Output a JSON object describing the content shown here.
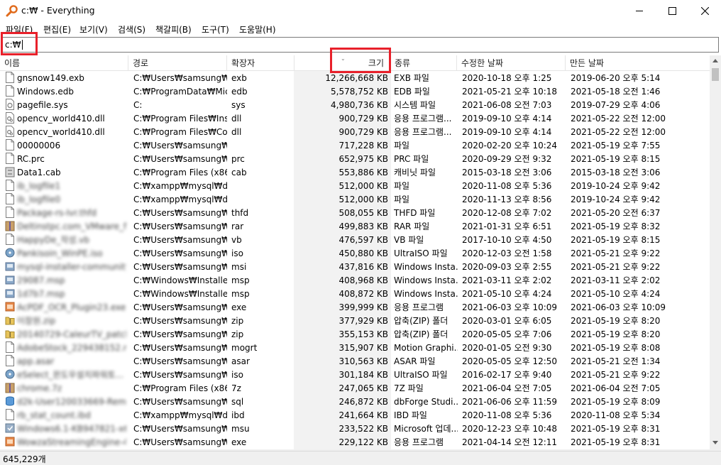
{
  "window": {
    "title": "c:₩ - Everything"
  },
  "menu": [
    "파일(F)",
    "편집(E)",
    "보기(V)",
    "검색(S)",
    "책갈피(B)",
    "도구(T)",
    "도움말(H)"
  ],
  "search": {
    "value": "c:₩"
  },
  "columns": {
    "name": "이름",
    "path": "경로",
    "ext": "확장자",
    "size": "크기",
    "type": "종류",
    "modified": "수정한 날짜",
    "created": "만든 날짜"
  },
  "rows": [
    {
      "name": "gnsnow149.exb",
      "path": "C:₩Users₩samsung₩E...",
      "ext": "exb",
      "size": "12,266,668 KB",
      "type": "EXB 파일",
      "modified": "2020-10-18 오후 1:25",
      "created": "2019-06-20 오후 5:14",
      "icon": "file-icon"
    },
    {
      "name": "Windows.edb",
      "path": "C:₩ProgramData₩Mic...",
      "ext": "edb",
      "size": "5,578,752 KB",
      "type": "EDB 파일",
      "modified": "2021-05-21 오후 10:18",
      "created": "2021-05-18 오전 1:46",
      "icon": "file-icon"
    },
    {
      "name": "pagefile.sys",
      "path": "C:",
      "ext": "sys",
      "size": "4,980,736 KB",
      "type": "시스템 파일",
      "modified": "2021-06-08 오전 7:03",
      "created": "2019-07-29 오후 4:06",
      "icon": "system-file-icon"
    },
    {
      "name": "opencv_world410.dll",
      "path": "C:₩Program Files₩Inst...",
      "ext": "dll",
      "size": "900,729 KB",
      "type": "응용 프로그램...",
      "modified": "2019-09-10 오후 4:14",
      "created": "2021-05-22 오전 12:00",
      "icon": "dll-file-icon"
    },
    {
      "name": "opencv_world410.dll",
      "path": "C:₩Program Files₩Co...",
      "ext": "dll",
      "size": "900,729 KB",
      "type": "응용 프로그램...",
      "modified": "2019-09-10 오후 4:14",
      "created": "2021-05-22 오전 12:00",
      "icon": "dll-file-icon"
    },
    {
      "name": "00000006",
      "path": "C:₩Users₩samsung₩...",
      "ext": "",
      "size": "717,228 KB",
      "type": "파일",
      "modified": "2020-02-20 오후 10:24",
      "created": "2021-05-19 오후 7:55",
      "icon": "file-icon"
    },
    {
      "name": "RC.prc",
      "path": "C:₩Users₩samsung₩...",
      "ext": "prc",
      "size": "652,975 KB",
      "type": "PRC 파일",
      "modified": "2020-09-29 오전 9:32",
      "created": "2021-05-19 오후 8:15",
      "icon": "file-icon"
    },
    {
      "name": "Data1.cab",
      "path": "C:₩Program Files (x86...",
      "ext": "cab",
      "size": "553,886 KB",
      "type": "캐비닛 파일",
      "modified": "2015-03-18 오전 3:06",
      "created": "2015-03-18 오전 3:06",
      "icon": "cabinet-file-icon"
    },
    {
      "name": "ib_logfile1",
      "path": "C:₩xampp₩mysql₩data",
      "ext": "",
      "size": "512,000 KB",
      "type": "파일",
      "modified": "2020-11-08 오후 5:36",
      "created": "2019-10-24 오후 9:42",
      "icon": "file-icon",
      "blur": true
    },
    {
      "name": "ib_logfile0",
      "path": "C:₩xampp₩mysql₩data",
      "ext": "",
      "size": "512,000 KB",
      "type": "파일",
      "modified": "2020-11-13 오후 8:56",
      "created": "2019-10-24 오후 9:42",
      "icon": "file-icon",
      "blur": true
    },
    {
      "name": "Package-rs-Ivr.thfd",
      "path": "C:₩Users₩samsung₩...",
      "ext": "thfd",
      "size": "508,055 KB",
      "type": "THFD 파일",
      "modified": "2020-12-08 오후 7:02",
      "created": "2021-05-20 오전 6:37",
      "icon": "file-icon",
      "blur": true
    },
    {
      "name": "Deltinstpc.com_VMware_f...",
      "path": "C:₩Users₩samsung₩...",
      "ext": "rar",
      "size": "499,883 KB",
      "type": "RAR 파일",
      "modified": "2021-01-31 오후 6:51",
      "created": "2021-05-19 오후 8:32",
      "icon": "archive-icon",
      "blur": true
    },
    {
      "name": "HappyDe_작성.vb",
      "path": "C:₩Users₩samsung₩...",
      "ext": "vb",
      "size": "476,597 KB",
      "type": "VB 파일",
      "modified": "2017-10-10 오후 4:50",
      "created": "2021-05-19 오후 8:15",
      "icon": "file-icon",
      "blur": true
    },
    {
      "name": "Pankisoin_WinPE.iso",
      "path": "C:₩Users₩samsung₩...",
      "ext": "iso",
      "size": "450,880 KB",
      "type": "UltraISO 파일",
      "modified": "2020-12-03 오전 1:58",
      "created": "2021-05-21 오후 9:22",
      "icon": "disc-image-icon",
      "blur": true
    },
    {
      "name": "mysql-installer-community...",
      "path": "C:₩Users₩samsung₩...",
      "ext": "msi",
      "size": "437,816 KB",
      "type": "Windows Insta...",
      "modified": "2020-09-03 오후 2:55",
      "created": "2021-05-21 오후 9:22",
      "icon": "installer-icon",
      "blur": true
    },
    {
      "name": "29087.msp",
      "path": "C:₩Windows₩Installer",
      "ext": "msp",
      "size": "408,968 KB",
      "type": "Windows Insta...",
      "modified": "2021-03-11 오후 2:02",
      "created": "2021-03-11 오후 2:02",
      "icon": "installer-icon",
      "blur": true
    },
    {
      "name": "1d7b7.msp",
      "path": "C:₩Windows₩Installer",
      "ext": "msp",
      "size": "408,872 KB",
      "type": "Windows Insta...",
      "modified": "2021-05-10 오후 4:24",
      "created": "2021-05-10 오후 4:24",
      "icon": "installer-icon",
      "blur": true
    },
    {
      "name": "AcPDF_OCR_Plugin23.exe",
      "path": "C:₩Users₩samsung₩...",
      "ext": "exe",
      "size": "399,999 KB",
      "type": "응용 프로그램",
      "modified": "2021-06-03 오후 10:09",
      "created": "2021-06-03 오후 10:09",
      "icon": "application-icon",
      "blur": true
    },
    {
      "name": "이창원.zip",
      "path": "C:₩Users₩samsung₩...",
      "ext": "zip",
      "size": "377,929 KB",
      "type": "압축(ZIP) 폴더",
      "modified": "2020-03-01 오후 6:05",
      "created": "2021-05-19 오후 8:20",
      "icon": "zip-folder-icon",
      "blur": true
    },
    {
      "name": "20140729-CaleurTV_patch...",
      "path": "C:₩Users₩samsung₩...",
      "ext": "zip",
      "size": "355,153 KB",
      "type": "압축(ZIP) 폴더",
      "modified": "2020-05-05 오후 7:06",
      "created": "2021-05-19 오후 8:20",
      "icon": "zip-folder-icon",
      "blur": true
    },
    {
      "name": "AdobeStock_229438152.m...",
      "path": "C:₩Users₩samsung₩...",
      "ext": "mogrt",
      "size": "315,907 KB",
      "type": "Motion Graphi...",
      "modified": "2020-01-05 오전 9:30",
      "created": "2021-05-19 오후 8:08",
      "icon": "file-icon",
      "blur": true
    },
    {
      "name": "app.asar",
      "path": "C:₩Users₩samsung₩...",
      "ext": "asar",
      "size": "310,563 KB",
      "type": "ASAR 파일",
      "modified": "2020-05-05 오후 12:50",
      "created": "2021-05-21 오전 1:34",
      "icon": "file-icon",
      "blur": true
    },
    {
      "name": "eSelect_윈도우설치파워토...",
      "path": "C:₩Users₩samsung₩...",
      "ext": "iso",
      "size": "301,184 KB",
      "type": "UltraISO 파일",
      "modified": "2016-02-17 오후 9:40",
      "created": "2021-05-21 오후 9:22",
      "icon": "disc-image-icon",
      "blur": true
    },
    {
      "name": "chrome.7z",
      "path": "C:₩Program Files (x86...",
      "ext": "7z",
      "size": "247,065 KB",
      "type": "7Z 파일",
      "modified": "2021-06-04 오전 7:05",
      "created": "2021-06-04 오전 7:05",
      "icon": "archive-icon",
      "blur": true
    },
    {
      "name": "d2k-User120033669-Rem...",
      "path": "C:₩Users₩samsung₩...",
      "ext": "sql",
      "size": "246,872 KB",
      "type": "dbForge Studi...",
      "modified": "2021-06-06 오후 11:59",
      "created": "2021-05-19 오후 8:09",
      "icon": "database-icon",
      "blur": true
    },
    {
      "name": "rb_stat_count.ibd",
      "path": "C:₩xampp₩mysql₩da...",
      "ext": "ibd",
      "size": "241,664 KB",
      "type": "IBD 파일",
      "modified": "2020-11-08 오후 5:36",
      "created": "2020-11-08 오후 5:34",
      "icon": "file-icon",
      "blur": true
    },
    {
      "name": "Windows6.1-KB947821-x6...",
      "path": "C:₩Users₩samsung₩...",
      "ext": "msu",
      "size": "233,522 KB",
      "type": "Microsoft 업데...",
      "modified": "2020-12-23 오후 10:48",
      "created": "2021-05-19 오후 8:31",
      "icon": "update-package-icon",
      "blur": true
    },
    {
      "name": "WowzaStreamingEngine-4...",
      "path": "C:₩Users₩samsung₩...",
      "ext": "exe",
      "size": "229,122 KB",
      "type": "응용 프로그램",
      "modified": "2021-04-14 오전 12:11",
      "created": "2021-05-19 오후 8:31",
      "icon": "application-icon",
      "blur": true
    }
  ],
  "status": {
    "count": "645,229개"
  },
  "colors": {
    "highlight": "#e8202a",
    "size_column_bg": "#f2f2f2",
    "app_icon": "#e06a1b"
  }
}
